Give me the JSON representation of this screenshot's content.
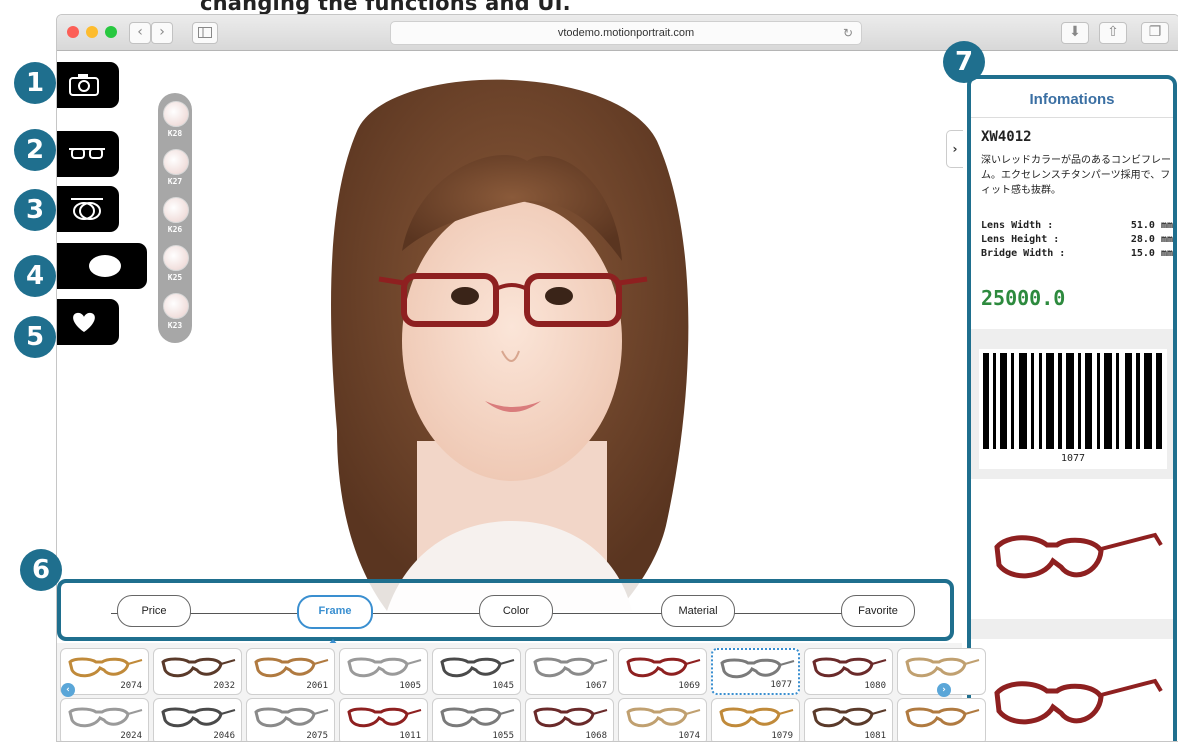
{
  "caption": "changing the functions and UI.",
  "browser": {
    "url": "vtodemo.motionportrait.com",
    "back_label": "‹",
    "forward_label": "›",
    "sidebar_icon": "sidebar-icon",
    "reload_label": "↻",
    "download_label": "⬇",
    "share_label": "⇧",
    "tabs_label": "❐"
  },
  "badges": [
    "1",
    "2",
    "3",
    "4",
    "5",
    "6",
    "7"
  ],
  "tools": [
    {
      "name": "camera-tool",
      "icon": "camera-icon"
    },
    {
      "name": "frame-tool",
      "icon": "glasses-frame-icon"
    },
    {
      "name": "lens-tool",
      "icon": "lens-icon"
    },
    {
      "name": "shape-tool",
      "icon": "oval-shape-icon"
    },
    {
      "name": "favorite-tool",
      "icon": "heart-icon"
    }
  ],
  "lenses": [
    "K28",
    "K27",
    "K26",
    "K25",
    "K23"
  ],
  "info": {
    "title": "Infomations",
    "model": "XW4012",
    "description": "深いレッドカラーが品のあるコンビフレーム。エクセレンスチタンパーツ採用で、フィット感も抜群。",
    "specs": [
      {
        "label": "Lens Width :",
        "value": "51.0 mm"
      },
      {
        "label": "Lens Height :",
        "value": "28.0 mm"
      },
      {
        "label": "Bridge Width :",
        "value": "15.0 mm"
      }
    ],
    "price": "25000.0",
    "barcode_number": "1077",
    "collapse_label": "›"
  },
  "filters": [
    {
      "label": "Price",
      "active": false
    },
    {
      "label": "Frame",
      "active": true
    },
    {
      "label": "Color",
      "active": false
    },
    {
      "label": "Material",
      "active": false
    },
    {
      "label": "Favorite",
      "active": false
    }
  ],
  "thumbnails_row1": [
    "2074",
    "2032",
    "2061",
    "1005",
    "1045",
    "1067",
    "1069",
    "1077",
    "1080",
    ""
  ],
  "thumbnails_row2": [
    "2024",
    "2046",
    "2075",
    "1011",
    "1055",
    "1068",
    "1074",
    "1079",
    "1081",
    ""
  ],
  "selected_thumbnail": "1077",
  "colors": {
    "accent": "#1f6f8e",
    "active": "#3a8fd0",
    "price": "#2d8a3e",
    "frame_red": "#8e2020"
  }
}
